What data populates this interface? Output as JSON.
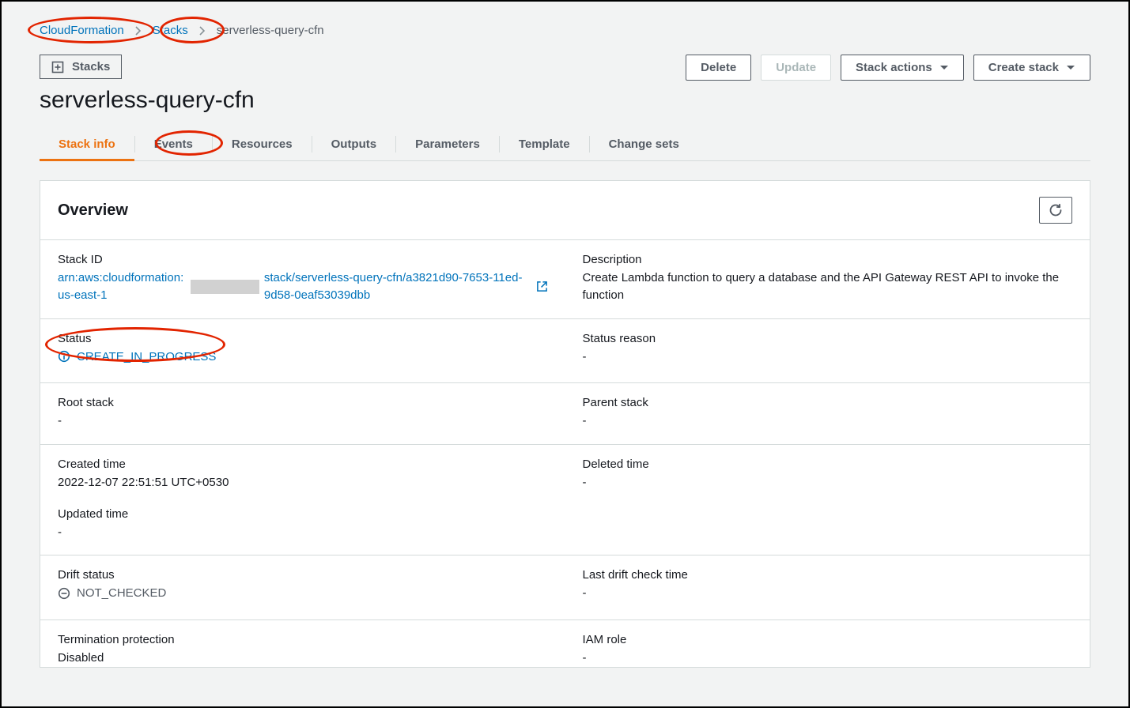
{
  "breadcrumb": {
    "root": "CloudFormation",
    "parent": "Stacks",
    "current": "serverless-query-cfn"
  },
  "sidebar_toggle": {
    "label": "Stacks"
  },
  "page_title": "serverless-query-cfn",
  "actions": {
    "delete": "Delete",
    "update": "Update",
    "stack_actions": "Stack actions",
    "create_stack": "Create stack"
  },
  "tabs": [
    "Stack info",
    "Events",
    "Resources",
    "Outputs",
    "Parameters",
    "Template",
    "Change sets"
  ],
  "active_tab": "Stack info",
  "overview": {
    "heading": "Overview",
    "stack_id": {
      "label": "Stack ID",
      "arn_prefix": "arn:aws:cloudformation:us-east-1",
      "arn_suffix": "stack/serverless-query-cfn/a3821d90-7653-11ed-9d58-0eaf53039dbb"
    },
    "description": {
      "label": "Description",
      "value": "Create Lambda function to query a database and the API Gateway REST API to invoke the function"
    },
    "status": {
      "label": "Status",
      "value": "CREATE_IN_PROGRESS"
    },
    "status_reason": {
      "label": "Status reason",
      "value": "-"
    },
    "root_stack": {
      "label": "Root stack",
      "value": "-"
    },
    "parent_stack": {
      "label": "Parent stack",
      "value": "-"
    },
    "created_time": {
      "label": "Created time",
      "value": "2022-12-07 22:51:51 UTC+0530"
    },
    "deleted_time": {
      "label": "Deleted time",
      "value": "-"
    },
    "updated_time": {
      "label": "Updated time",
      "value": "-"
    },
    "drift_status": {
      "label": "Drift status",
      "value": "NOT_CHECKED"
    },
    "last_drift_check": {
      "label": "Last drift check time",
      "value": "-"
    },
    "termination_protection": {
      "label": "Termination protection",
      "value": "Disabled"
    },
    "iam_role": {
      "label": "IAM role",
      "value": "-"
    }
  }
}
